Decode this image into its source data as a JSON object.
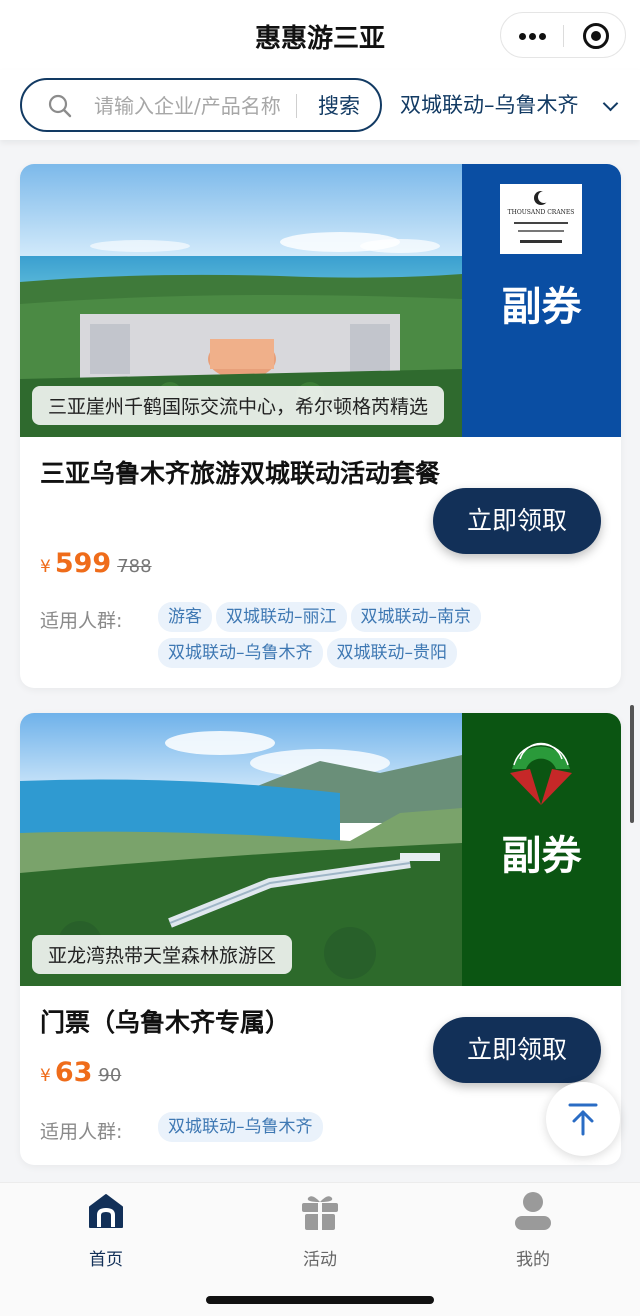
{
  "header": {
    "title": "惠惠游三亚",
    "more_icon": "more-dots-icon",
    "close_icon": "target-circle-icon"
  },
  "search": {
    "placeholder": "请输入企业/产品名称",
    "button_label": "搜索",
    "city_selected": "双城联动–乌鲁木齐"
  },
  "cards": [
    {
      "image_caption": "三亚崖州千鹤国际交流中心，希尔顿格芮精选",
      "brand_logo_text": "THOUSAND CRANES",
      "brand_color": "#0a4ea3",
      "voucher_label": "副券",
      "title": "三亚乌鲁木齐旅游双城联动活动套餐",
      "currency": "¥",
      "price": "599",
      "original_price": "788",
      "claim_label": "立即领取",
      "audience_label": "适用人群:",
      "tags": [
        "游客",
        "双城联动–丽江",
        "双城联动–南京",
        "双城联动–乌鲁木齐",
        "双城联动–贵阳"
      ]
    },
    {
      "image_caption": "亚龙湾热带天堂森林旅游区",
      "brand_color": "#0b5512",
      "voucher_label": "副券",
      "title": "门票（乌鲁木齐专属）",
      "currency": "¥",
      "price": "63",
      "original_price": "90",
      "claim_label": "立即领取",
      "audience_label": "适用人群:",
      "tags": [
        "双城联动–乌鲁木齐"
      ]
    }
  ],
  "bottom_nav": [
    {
      "label": "首页",
      "icon": "home-icon",
      "active": true
    },
    {
      "label": "活动",
      "icon": "gift-icon",
      "active": false
    },
    {
      "label": "我的",
      "icon": "user-icon",
      "active": false
    }
  ],
  "back_to_top_icon": "arrow-up-to-top-icon"
}
